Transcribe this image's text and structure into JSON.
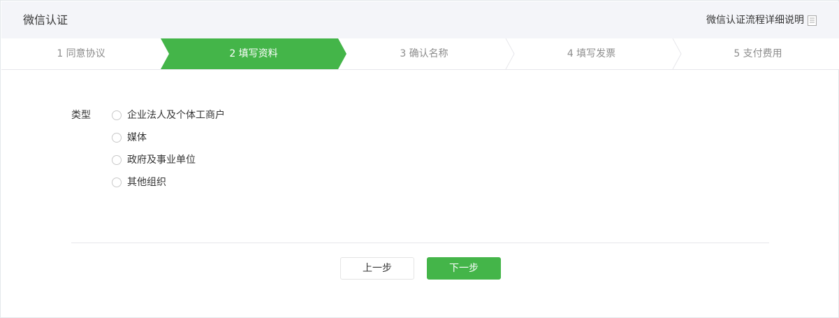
{
  "header": {
    "title": "微信认证",
    "help_link": "微信认证流程详细说明",
    "help_icon": "document-icon"
  },
  "steps": [
    {
      "label": "1 同意协议",
      "state": "done"
    },
    {
      "label": "2 填写资料",
      "state": "active"
    },
    {
      "label": "3 确认名称",
      "state": "todo"
    },
    {
      "label": "4 填写发票",
      "state": "todo"
    },
    {
      "label": "5 支付费用",
      "state": "todo"
    }
  ],
  "form": {
    "type_label": "类型",
    "options": [
      {
        "label": "企业法人及个体工商户",
        "selected": false
      },
      {
        "label": "媒体",
        "selected": false
      },
      {
        "label": "政府及事业单位",
        "selected": false
      },
      {
        "label": "其他组织",
        "selected": false
      }
    ]
  },
  "buttons": {
    "prev": "上一步",
    "next": "下一步"
  },
  "colors": {
    "accent": "#44b549",
    "header_bg": "#f4f5f9",
    "step_text": "#8d8d8d"
  }
}
